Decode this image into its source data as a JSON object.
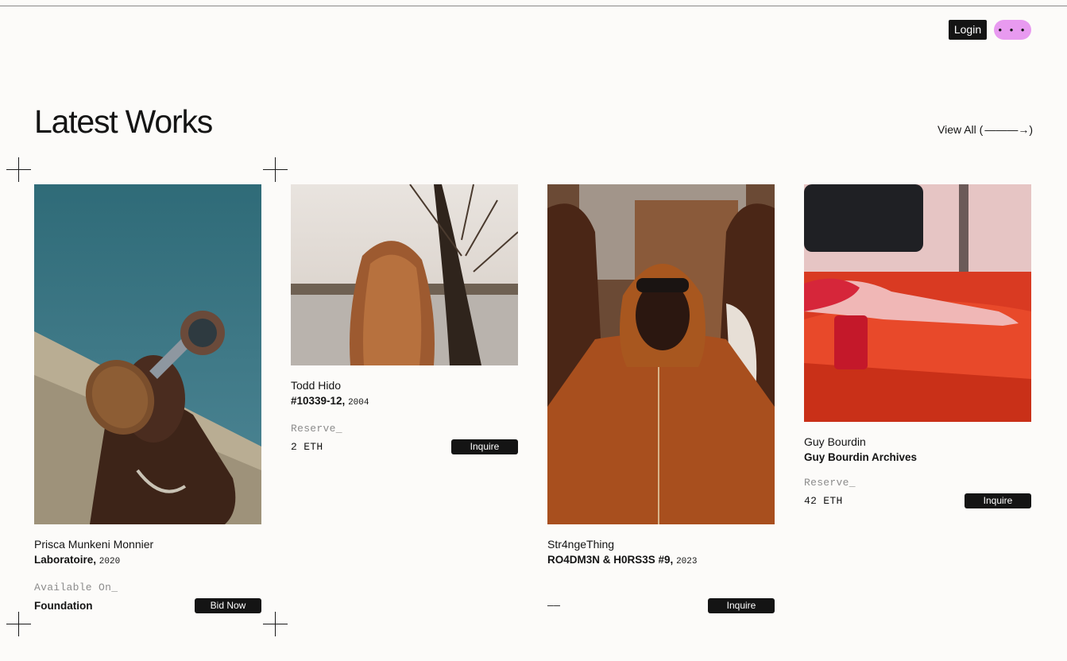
{
  "header": {
    "login_label": "Login",
    "menu_label": "• • •",
    "menu_color": "#e89af0"
  },
  "section": {
    "title": "Latest Works",
    "view_all_label": "View All (",
    "view_all_arrow": "———→)"
  },
  "works": [
    {
      "artist": "Prisca Munkeni Monnier",
      "title": "Laboratoire,",
      "year": "2020",
      "meta_label": "Available On_",
      "meta_value": "Foundation",
      "action": "Bid Now"
    },
    {
      "artist": "Todd Hido",
      "title": "#10339-12,",
      "year": "2004",
      "meta_label": "Reserve_",
      "meta_value": "2 ETH",
      "action": "Inquire"
    },
    {
      "artist": "Str4ngeThing",
      "title": "RO4DM3N & H0RS3S #9,",
      "year": "2023",
      "meta_label": "",
      "meta_value": "——",
      "action": "Inquire"
    },
    {
      "artist": "Guy Bourdin",
      "title": "Guy Bourdin Archives",
      "year": "",
      "meta_label": "Reserve_",
      "meta_value": "42 ETH",
      "action": "Inquire"
    }
  ],
  "colors": {
    "background": "#fcfbf9",
    "text": "#141414",
    "button": "#141414",
    "muted": "#8c8c8c"
  }
}
